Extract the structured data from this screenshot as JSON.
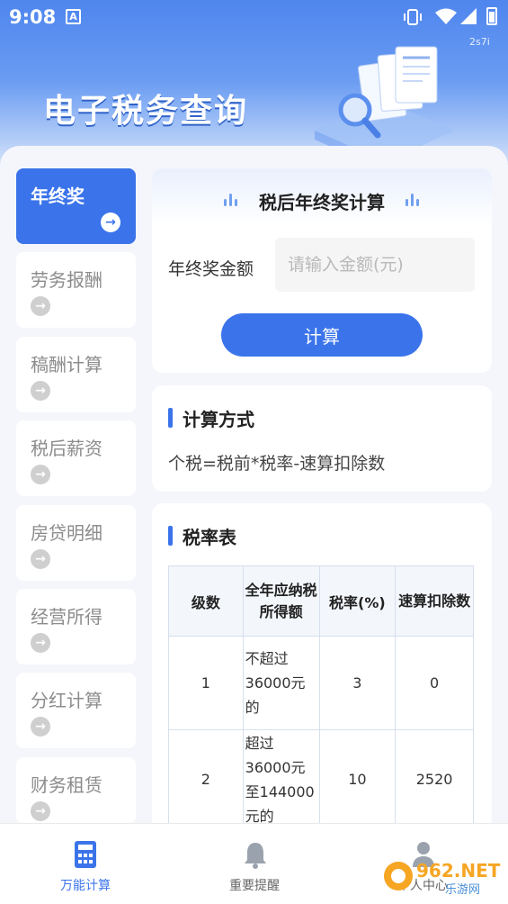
{
  "status_bar": {
    "time": "9:08",
    "notification_icon": "A",
    "badge": "2s7i"
  },
  "header": {
    "title": "电子税务查询"
  },
  "sidebar": {
    "items": [
      {
        "label": "年终奖",
        "active": true
      },
      {
        "label": "劳务报酬",
        "active": false
      },
      {
        "label": "稿酬计算",
        "active": false
      },
      {
        "label": "税后薪资",
        "active": false
      },
      {
        "label": "房贷明细",
        "active": false
      },
      {
        "label": "经营所得",
        "active": false
      },
      {
        "label": "分红计算",
        "active": false
      },
      {
        "label": "财务租赁",
        "active": false
      }
    ],
    "arrow_glyph": "→"
  },
  "calculator": {
    "title": "税后年终奖计算",
    "field_label": "年终奖金额",
    "input_placeholder": "请输入金额(元)",
    "input_value": "",
    "button_label": "计算"
  },
  "method": {
    "title": "计算方式",
    "formula": "个税=税前*税率-速算扣除数"
  },
  "rate_table": {
    "title": "税率表",
    "headers": [
      "级数",
      "全年应纳税所得额",
      "税率(%)",
      "速算扣除数"
    ],
    "rows": [
      {
        "level": "1",
        "range": "不超过36000元的",
        "rate": "3",
        "deduction": "0"
      },
      {
        "level": "2",
        "range": "超过36000元至144000元的",
        "rate": "10",
        "deduction": "2520"
      }
    ]
  },
  "bottom_nav": {
    "items": [
      {
        "label": "万能计算",
        "active": true
      },
      {
        "label": "重要提醒",
        "active": false
      },
      {
        "label": "个人中心",
        "active": false
      }
    ]
  },
  "watermark": {
    "text": "962.NET",
    "subtext": "乐游网"
  },
  "colors": {
    "accent": "#3b74ea",
    "header_top": "#4f86ee",
    "inactive_text": "#8c8c8c"
  }
}
